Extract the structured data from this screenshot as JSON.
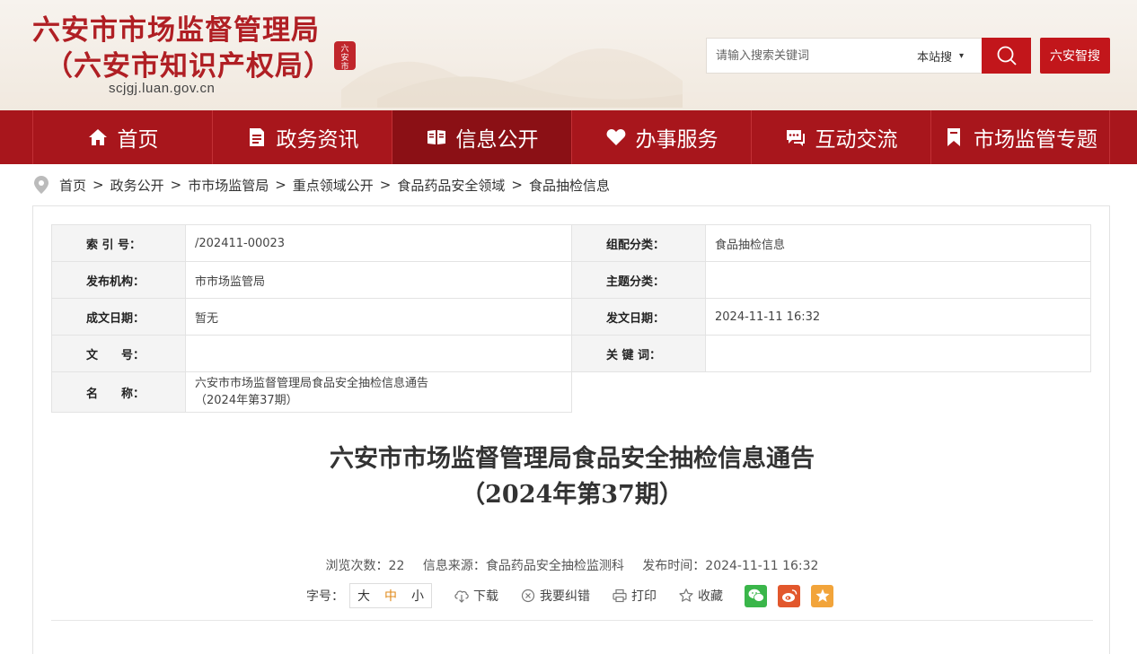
{
  "header": {
    "title_line1": "六安市市场监督管理局",
    "title_line2": "（六安市知识产权局）",
    "url": "scjgj.luan.gov.cn",
    "seal_text": "六安市",
    "search": {
      "placeholder": "请输入搜索关键词",
      "scope": "本站搜"
    },
    "smart_search_label": "六安智搜",
    "brand_color": "#a8161c"
  },
  "nav": {
    "items": [
      {
        "label": "首页",
        "icon": "home-icon"
      },
      {
        "label": "政务资讯",
        "icon": "document-icon"
      },
      {
        "label": "信息公开",
        "icon": "open-book-icon"
      },
      {
        "label": "办事服务",
        "icon": "heart-icon"
      },
      {
        "label": "互动交流",
        "icon": "chat-icon"
      },
      {
        "label": "市场监管专题",
        "icon": "bookmark-icon"
      }
    ],
    "active": "信息公开"
  },
  "breadcrumb": [
    "首页",
    "政务公开",
    "市市场监管局",
    "重点领域公开",
    "食品药品安全领域",
    "食品抽检信息"
  ],
  "meta": {
    "index_label": "索 引 号：",
    "index_value": "/202411-00023",
    "group_label": "组配分类：",
    "group_value": "食品抽检信息",
    "publisher_label": "发布机构：",
    "publisher_value": "市市场监管局",
    "topic_label": "主题分类：",
    "topic_value": "",
    "created_label": "成文日期：",
    "created_value": "暂无",
    "published_label": "发文日期：",
    "published_value": "2024-11-11 16:32",
    "docno_label": "文　　号：",
    "docno_value": "",
    "keywords_label": "关 键 词：",
    "keywords_value": "",
    "name_label": "名　　称：",
    "name_value_line1": "六安市市场监督管理局食品安全抽检信息通告",
    "name_value_line2": "（2024年第37期）"
  },
  "article": {
    "title_line1": "六安市市场监督管理局食品安全抽检信息通告",
    "title_line2": "（2024年第37期）",
    "views": "浏览次数：22",
    "source": "信息来源：食品药品安全抽检监测科",
    "time": "发布时间：2024-11-11 16:32"
  },
  "toolbar": {
    "font_size_label": "字号：",
    "sizes": [
      "大",
      "中",
      "小"
    ],
    "active_size": "中",
    "download": "下载",
    "correction": "我要纠错",
    "print": "打印",
    "favorite": "收藏"
  }
}
